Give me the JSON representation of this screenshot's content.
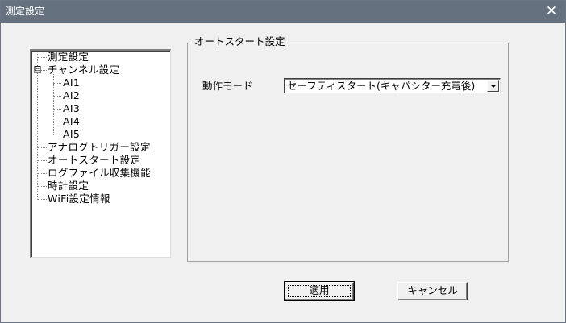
{
  "window": {
    "title": "測定設定",
    "close_glyph": "✕"
  },
  "tree": {
    "items": [
      {
        "label": "測定設定"
      },
      {
        "label": "チャンネル設定",
        "expander": "⊟"
      },
      {
        "label": "AI1"
      },
      {
        "label": "AI2"
      },
      {
        "label": "AI3"
      },
      {
        "label": "AI4"
      },
      {
        "label": "AI5"
      },
      {
        "label": "アナログトリガー設定"
      },
      {
        "label": "オートスタート設定"
      },
      {
        "label": "ログファイル収集機能"
      },
      {
        "label": "時計設定"
      },
      {
        "label": "WiFi設定情報"
      }
    ]
  },
  "group": {
    "title": "オートスタート設定",
    "field_label": "動作モード",
    "mode_value": "セーフティスタート(キャパシター充電後)"
  },
  "buttons": {
    "apply": "適用",
    "cancel": "キャンセル"
  }
}
